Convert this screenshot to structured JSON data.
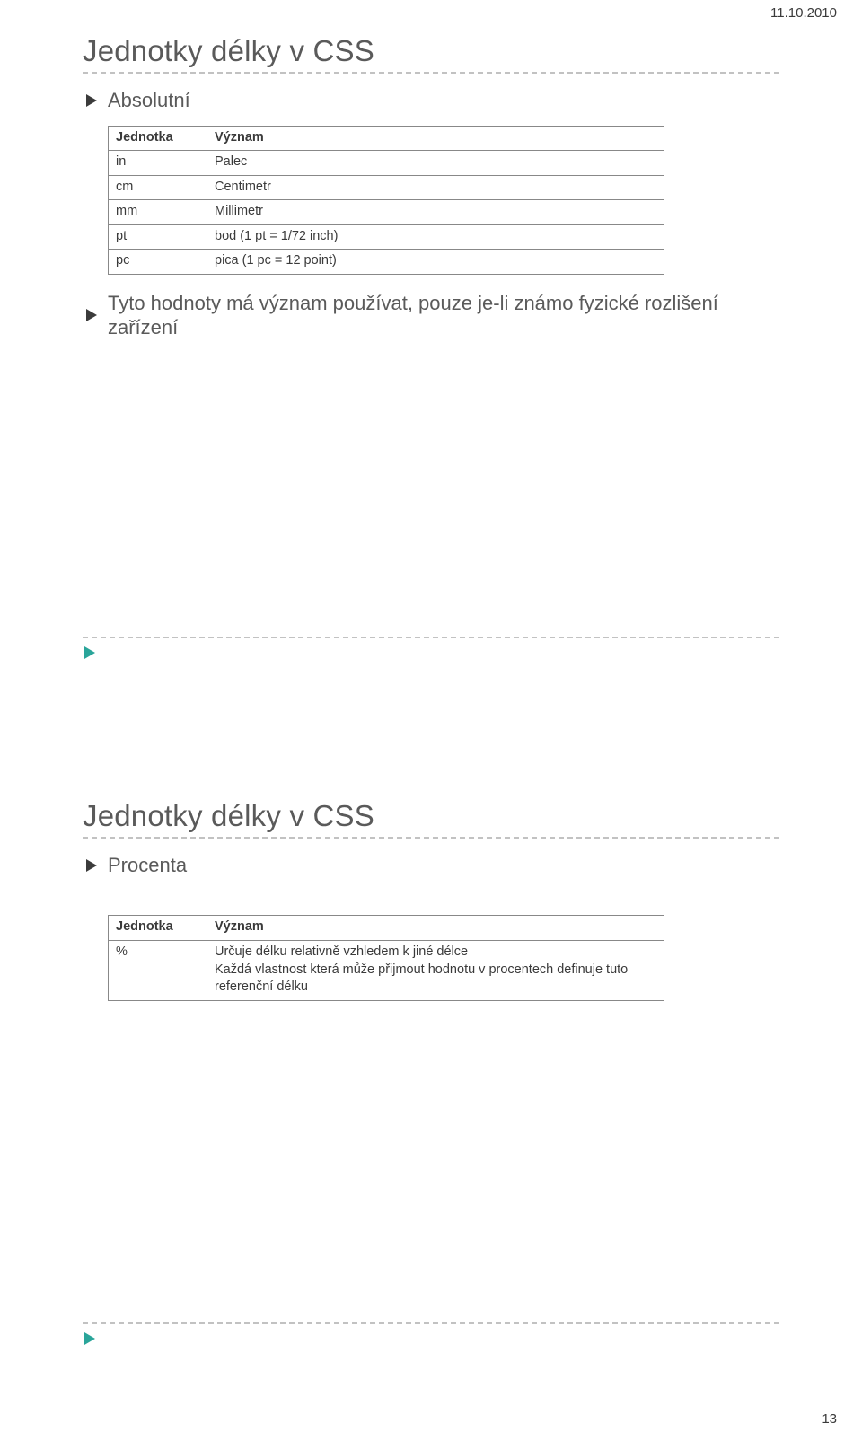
{
  "page": {
    "date": "11.10.2010",
    "number": "13"
  },
  "slide1": {
    "title": "Jednotky délky v CSS",
    "bullet1": "Absolutní",
    "bullet2": "Tyto hodnoty má význam používat, pouze je-li známo fyzické rozlišení zařízení",
    "table": {
      "header1": "Jednotka",
      "header2": "Význam",
      "rows": [
        {
          "c1": "in",
          "c2": "Palec"
        },
        {
          "c1": "cm",
          "c2": "Centimetr"
        },
        {
          "c1": "mm",
          "c2": "Millimetr"
        },
        {
          "c1": "pt",
          "c2": "bod (1 pt = 1/72 inch)"
        },
        {
          "c1": "pc",
          "c2": "pica (1 pc = 12 point)"
        }
      ]
    }
  },
  "slide2": {
    "title": "Jednotky délky v CSS",
    "bullet1": "Procenta",
    "table": {
      "header1": "Jednotka",
      "header2": "Význam",
      "rows": [
        {
          "c1": "%",
          "c2": "Určuje délku relativně vzhledem k jiné délce\nKaždá vlastnost která může přijmout hodnotu v procentech definuje tuto referenční délku"
        }
      ]
    }
  },
  "colors": {
    "arrow_dark": "#3b3b3b",
    "arrow_teal": "#2aa59a"
  }
}
